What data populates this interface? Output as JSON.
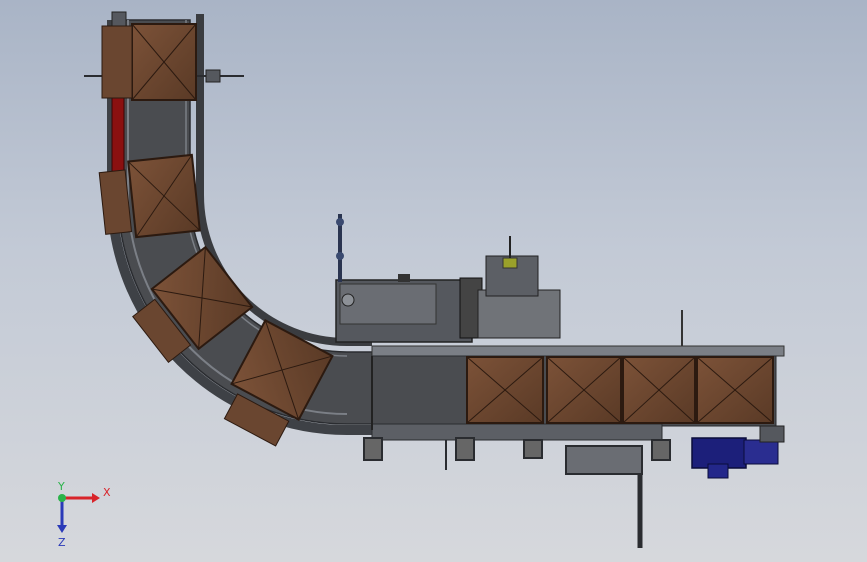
{
  "viewport": {
    "background_top": "#a9b4c6",
    "background_bottom": "#d6d8dc"
  },
  "model": {
    "colors": {
      "frame": "#3e4146",
      "belt": "#4a4c50",
      "rail": "#7b7f86",
      "box": "#6a4630",
      "box_edge": "#2c1a10",
      "box_flap": "#7c5238",
      "motor": "#1c1f7a",
      "guide_red": "#8a1010",
      "machine": "#55585e"
    },
    "components": [
      "curved-roller-conveyor",
      "straight-belt-conveyor",
      "carton-sealing-machine",
      "drive-motor",
      "support-legs"
    ],
    "cartons_on_straight": 4,
    "cartons_on_curve": 4
  },
  "triad": {
    "x_label": "X",
    "y_label": "Y",
    "z_label": "Z",
    "x_color": "#d8242a",
    "y_color": "#2bb34a",
    "z_color": "#2a3ab8"
  }
}
